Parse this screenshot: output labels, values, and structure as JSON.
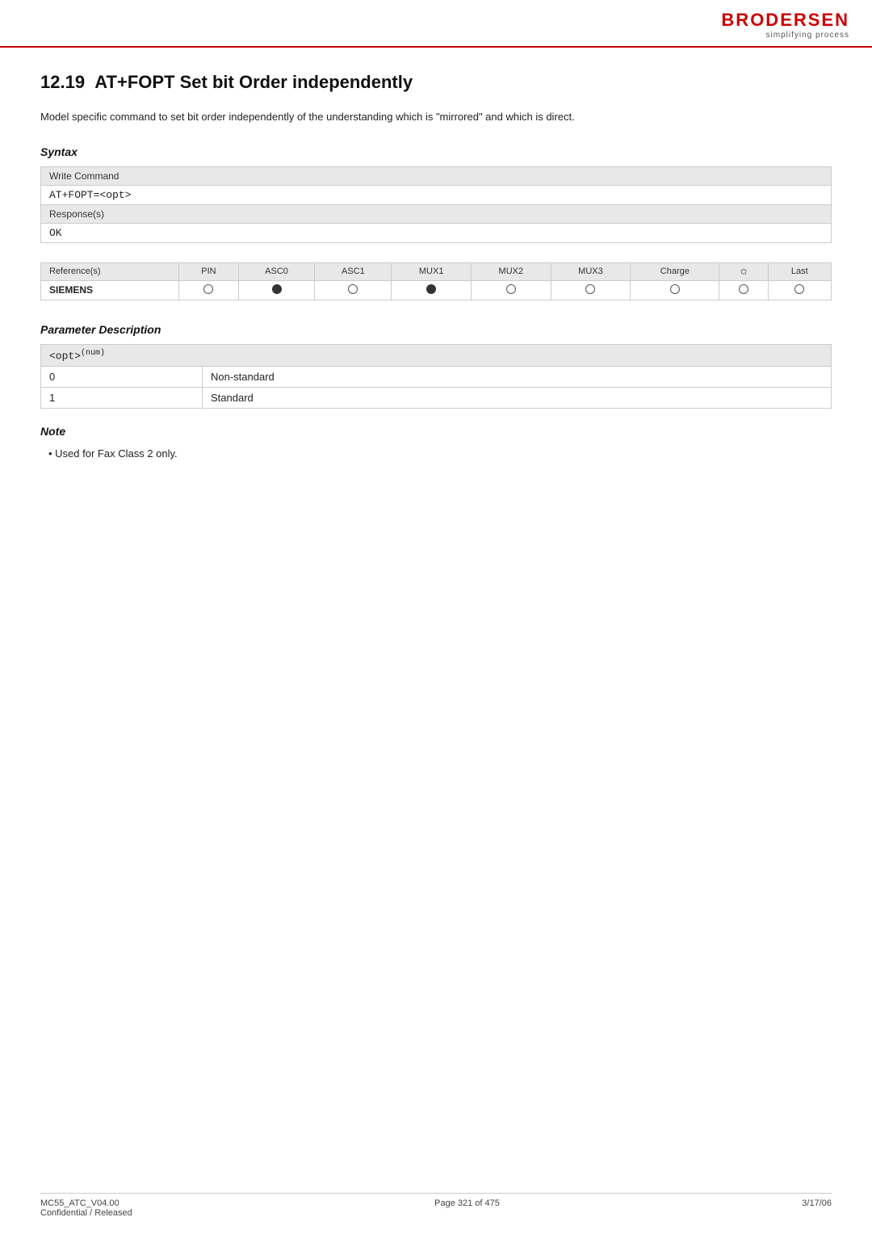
{
  "header": {
    "brand": "BRODERSEN",
    "tagline": "simplifying process"
  },
  "section": {
    "number": "12.19",
    "title": "AT+FOPT  Set bit Order independently",
    "description": "Model specific command to set bit order independently of the understanding which is \"mirrored\" and which is direct."
  },
  "syntax": {
    "label": "Syntax",
    "write_command_label": "Write Command",
    "write_command_code": "AT+FOPT=<opt>",
    "responses_label": "Response(s)",
    "ok_response": "OK"
  },
  "reference_table": {
    "label": "Reference(s)",
    "columns": [
      "PIN",
      "ASC0",
      "ASC1",
      "MUX1",
      "MUX2",
      "MUX3",
      "Charge",
      "✩",
      "Last"
    ],
    "rows": [
      {
        "name": "SIEMENS",
        "circles": [
          "empty",
          "filled",
          "empty",
          "filled",
          "empty",
          "empty",
          "empty",
          "empty",
          "empty"
        ]
      }
    ]
  },
  "parameter_description": {
    "label": "Parameter Description",
    "param_label": "<opt>",
    "param_superscript": "(num)",
    "params": [
      {
        "value": "0",
        "description": "Non-standard"
      },
      {
        "value": "1",
        "description": "Standard"
      }
    ]
  },
  "note": {
    "label": "Note",
    "items": [
      "Used for Fax Class 2 only."
    ]
  },
  "footer": {
    "left_line1": "MC55_ATC_V04.00",
    "left_line2": "Confidential / Released",
    "center": "Page 321 of 475",
    "right": "3/17/06"
  }
}
